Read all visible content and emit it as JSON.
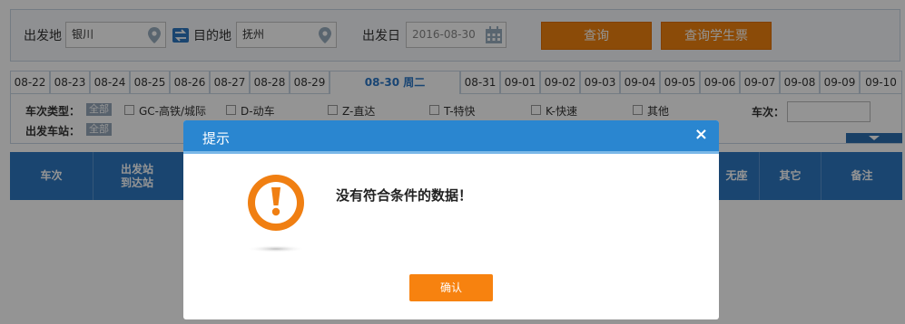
{
  "search": {
    "from_label": "出发地",
    "from_value": "银川",
    "to_label": "目的地",
    "to_value": "抚州",
    "date_label": "出发日",
    "date_value": "2016-08-30",
    "query_button": "查询",
    "student_button": "查询学生票"
  },
  "date_tabs": [
    "08-22",
    "08-23",
    "08-24",
    "08-25",
    "08-26",
    "08-27",
    "08-28",
    "08-29",
    "08-30 周二",
    "08-31",
    "09-01",
    "09-02",
    "09-03",
    "09-04",
    "09-05",
    "09-06",
    "09-07",
    "09-08",
    "09-09",
    "09-10"
  ],
  "filters": {
    "type_label": "车次类型：",
    "all_tag": "全部",
    "types": [
      "GC-高铁/城际",
      "D-动车",
      "Z-直达",
      "T-特快",
      "K-快速",
      "其他"
    ],
    "station_label": "出发车站：",
    "station_all": "全部",
    "train_no_label": "车次："
  },
  "table_header": {
    "col_train": "车次",
    "col_station_line1": "出发站",
    "col_station_line2": "到达站",
    "col_noseat": "无座",
    "col_other": "其它",
    "col_note": "备注"
  },
  "dialog": {
    "title": "提示",
    "close_symbol": "×",
    "message": "没有符合条件的数据！",
    "confirm": "确认"
  },
  "colors": {
    "accent_blue": "#2a86d0",
    "accent_orange": "#f7820f"
  }
}
